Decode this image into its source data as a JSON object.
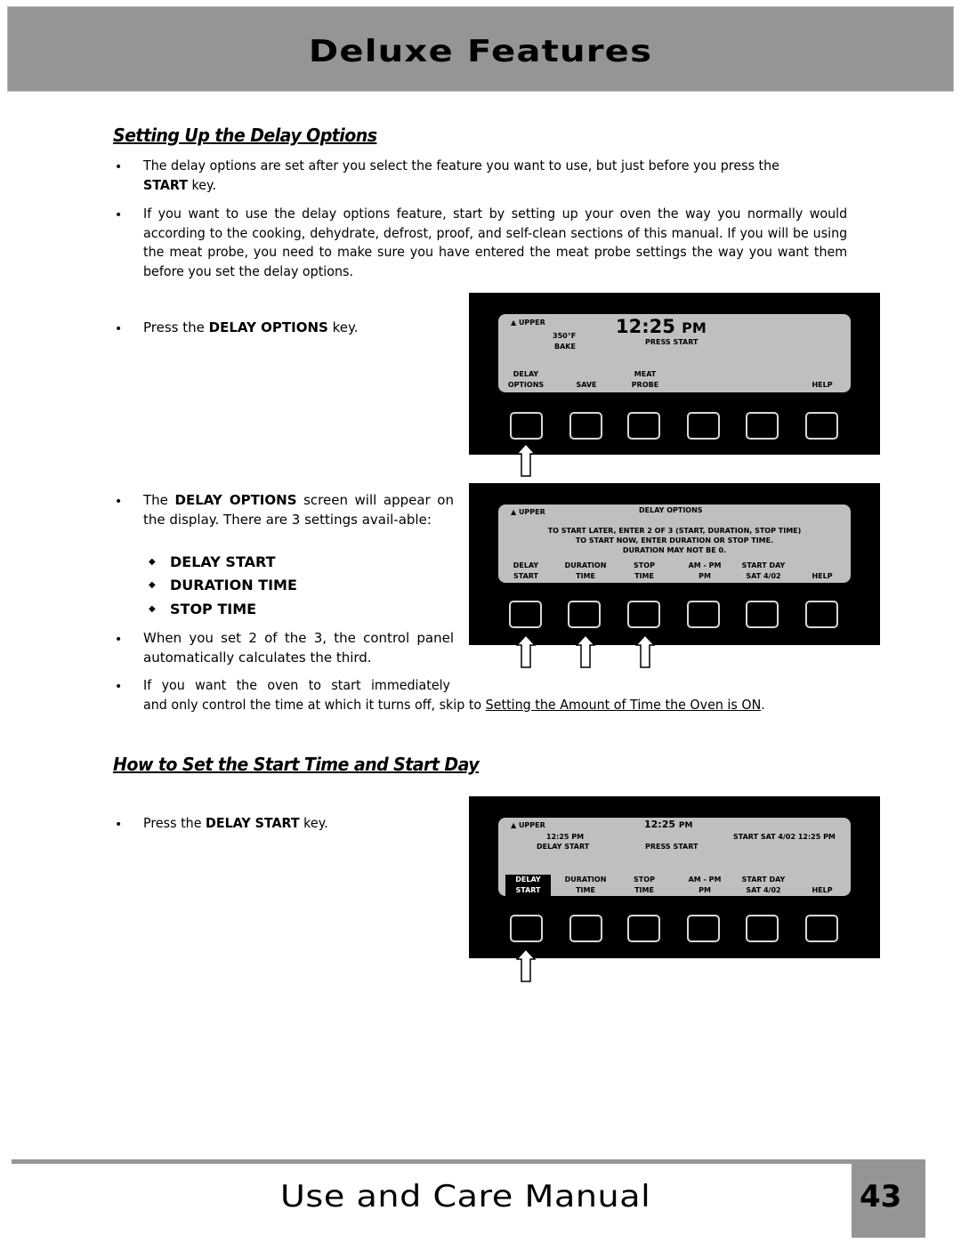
{
  "header": {
    "title": "Deluxe Features"
  },
  "section1": {
    "title": "Setting Up the Delay Options",
    "bullet1": {
      "text": "The delay options are set after you select the feature you want to use, but just before you press the",
      "bold": "START",
      "after": " key."
    },
    "bullet2": {
      "text": "If you want to use the delay options feature, start by setting up your oven the way you normally would according to the cooking, dehydrate, defrost, proof, and self-clean sections of this manual. If you will be using the meat probe, you need to make sure you have entered the meat probe settings the way you want them before you set the delay options."
    },
    "bullet3": {
      "before": "Press the ",
      "bold": "DELAY OPTIONS",
      "after": " key."
    },
    "bullet4": {
      "before": "The ",
      "bold": "DELAY OPTIONS",
      "after": " screen will appear on the display. There are 3 settings avail-able:"
    },
    "settings": [
      "DELAY START",
      "DURATION TIME",
      "STOP TIME"
    ],
    "bullet5": {
      "text": "When you set 2 of the 3, the control panel automatically calculates the third."
    },
    "bullet6": {
      "line1": "If you want the oven to start immediately",
      "line2_before": "and only control the time at which it turns off, skip to ",
      "link": "Setting the Amount of Time the Oven is ON",
      "after": "."
    }
  },
  "section2": {
    "title": "How to Set the Start Time and Start Day",
    "bullet1": {
      "before": "Press the ",
      "bold": "DELAY START",
      "after": " key."
    }
  },
  "panel1": {
    "oven": "▲ UPPER",
    "temp": "350°F",
    "mode": "BAKE",
    "clock": "12:25",
    "clock_suffix": "PM",
    "status": "PRESS START",
    "softkeys": [
      {
        "line1": "DELAY",
        "line2": "OPTIONS"
      },
      {
        "line1": "",
        "line2": "SAVE"
      },
      {
        "line1": "MEAT",
        "line2": "PROBE"
      },
      {
        "line1": "",
        "line2": ""
      },
      {
        "line1": "",
        "line2": ""
      },
      {
        "line1": "",
        "line2": "HELP"
      }
    ]
  },
  "panel2": {
    "oven": "▲ UPPER",
    "screen_title": "DELAY OPTIONS",
    "msg1": "TO START LATER, ENTER 2 OF 3 (START, DURATION, STOP TIME)",
    "msg2": "TO START NOW, ENTER DURATION OR STOP TIME.",
    "msg3": "DURATION MAY NOT BE 0.",
    "softkeys": [
      {
        "line1": "DELAY",
        "line2": "START"
      },
      {
        "line1": "DURATION",
        "line2": "TIME"
      },
      {
        "line1": "STOP",
        "line2": "TIME"
      },
      {
        "line1": "AM - PM",
        "line2": "PM"
      },
      {
        "line1": "START DAY",
        "line2": "SAT  4/02"
      },
      {
        "line1": "",
        "line2": "HELP"
      }
    ]
  },
  "panel3": {
    "oven": "▲ UPPER",
    "clock": "12:25",
    "clock_suffix": "PM",
    "delay_time": "12:25 PM",
    "delay_label": "DELAY START",
    "status": "PRESS START",
    "start_info": "START SAT  4/02 12:25 PM",
    "softkeys": [
      {
        "line1": "DELAY",
        "line2": "START"
      },
      {
        "line1": "DURATION",
        "line2": "TIME"
      },
      {
        "line1": "STOP",
        "line2": "TIME"
      },
      {
        "line1": "AM - PM",
        "line2": "PM"
      },
      {
        "line1": "START DAY",
        "line2": "SAT  4/02"
      },
      {
        "line1": "",
        "line2": "HELP"
      }
    ]
  },
  "footer": {
    "title": "Use and Care Manual",
    "page": "43"
  }
}
